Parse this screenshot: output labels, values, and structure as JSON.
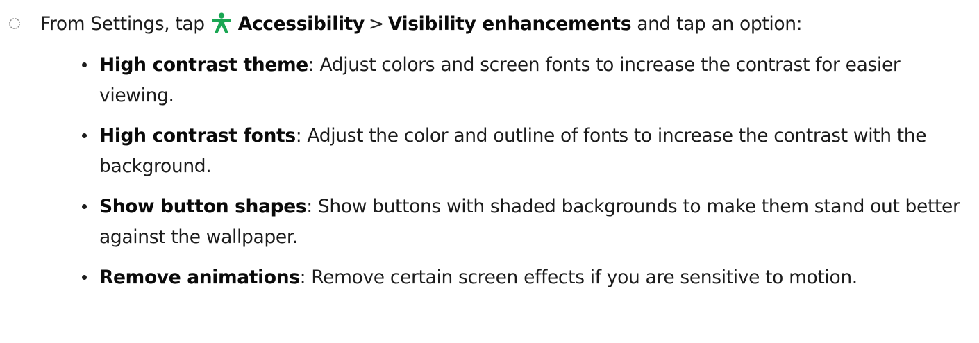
{
  "step": {
    "prefix": "From Settings, tap",
    "icon": "accessibility-icon",
    "icon_color": "#1aa653",
    "link1": "Accessibility",
    "separator": ">",
    "link2": "Visibility enhancements",
    "suffix": "and tap an option:"
  },
  "options": [
    {
      "term": "High contrast theme",
      "description": ": Adjust colors and screen fonts to increase the contrast for easier viewing."
    },
    {
      "term": "High contrast fonts",
      "description": ": Adjust the color and outline of fonts to increase the contrast with the background."
    },
    {
      "term": "Show button shapes",
      "description": ": Show buttons with shaded backgrounds to make them stand out better against the wallpaper."
    },
    {
      "term": "Remove animations",
      "description": ": Remove certain screen effects if you are sensitive to motion."
    }
  ]
}
